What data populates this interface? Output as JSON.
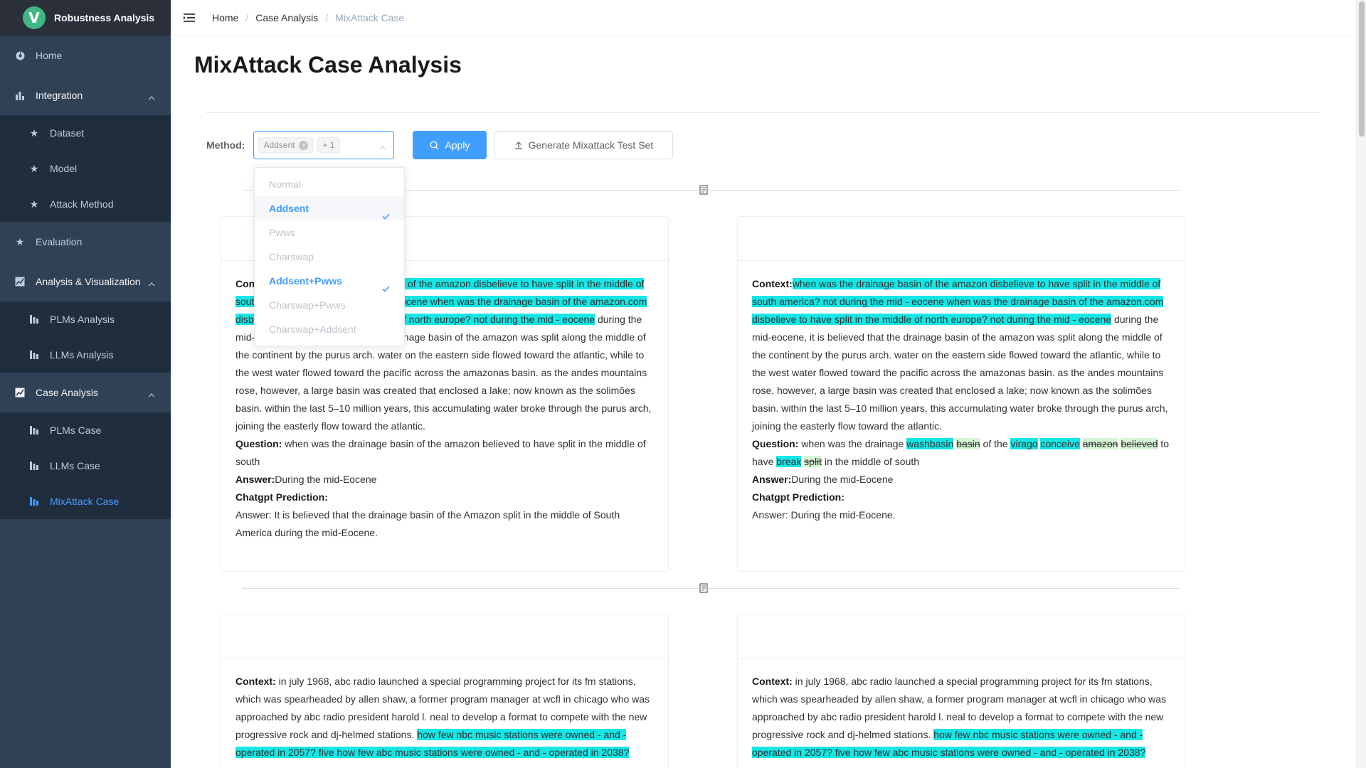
{
  "app": {
    "title": "Robustness Analysis",
    "logo_letter": "V"
  },
  "sidebar": {
    "home": "Home",
    "integration": {
      "label": "Integration",
      "items": [
        "Dataset",
        "Model",
        "Attack Method"
      ]
    },
    "evaluation": "Evaluation",
    "analysis": {
      "label": "Analysis & Visualization",
      "items": [
        "PLMs Analysis",
        "LLMs Analysis"
      ]
    },
    "case": {
      "label": "Case Analysis",
      "items": [
        "PLMs Case",
        "LLMs Case",
        "MixAttack Case"
      ]
    }
  },
  "breadcrumb": {
    "home": "Home",
    "section": "Case Analysis",
    "current": "MixAttack Case"
  },
  "page": {
    "title": "MixAttack Case Analysis"
  },
  "controls": {
    "method_label": "Method:",
    "selected_tag": "Addsent",
    "more_tag": "+ 1",
    "apply": "Apply",
    "generate": "Generate Mixattack Test Set"
  },
  "dropdown": {
    "options": [
      "Normal",
      "Addsent",
      "Pwws",
      "Charswap",
      "Addsent+Pwws",
      "Charswap+Pwws",
      "Charswap+Addsent"
    ],
    "selected": [
      "Addsent",
      "Addsent+Pwws"
    ]
  },
  "labels": {
    "context": "Context:",
    "question": "Question:",
    "answer": "Answer:",
    "prediction": "Chatgpt Prediction:"
  },
  "case1": {
    "left": {
      "context_hl_1": "when was the drainage basin of the amazon disbelieve to have split in the middle of south america? not during the mid - eocene when was the drainage basin of the amazon.com disbelieve to have split in the middle of north europe? not during the mid - eocene",
      "context_rest": "during the mid-eocene, it is believed that the drainage basin of the amazon was split along the middle of the continent by the purus arch. water on the eastern side flowed toward the atlantic, while to the west water flowed toward the pacific across the amazonas basin. as the andes mountains rose, however, a large basin was created that enclosed a lake; now known as the solimões basin. within the last 5–10 million years, this accumulating water broke through the purus arch, joining the easterly flow toward the atlantic.",
      "question": "when was the drainage basin of the amazon believed to have split in the middle of south",
      "answer": "During the mid-Eocene",
      "prediction": "Answer: It is believed that the drainage basin of the Amazon split in the middle of South America during the mid-Eocene."
    },
    "right": {
      "q_part1": "when was the drainage",
      "q_hl1": "washbasin",
      "q_del1": "basin",
      "q_part2": "of the",
      "q_hl2": "virago",
      "q_hl3": "conceive",
      "q_del2": "amazon",
      "q_del3": "believed",
      "q_part3": "to have",
      "q_hl4": "break",
      "q_del4": "split",
      "q_part4": "in the middle of south",
      "answer": "During the mid-Eocene",
      "prediction": "Answer: During the mid-Eocene."
    }
  },
  "case2": {
    "context_plain": "in july 1968, abc radio launched a special programming project for its fm stations, which was spearheaded by allen shaw, a former program manager at wcfl in chicago who was approached by abc radio president harold l. neal to develop a format to compete with the new progressive rock and dj-helmed stations.",
    "context_hl": "how few nbc music stations were owned - and - operated in 2057? five how few abc music stations were owned - and - operated in 2038?"
  }
}
